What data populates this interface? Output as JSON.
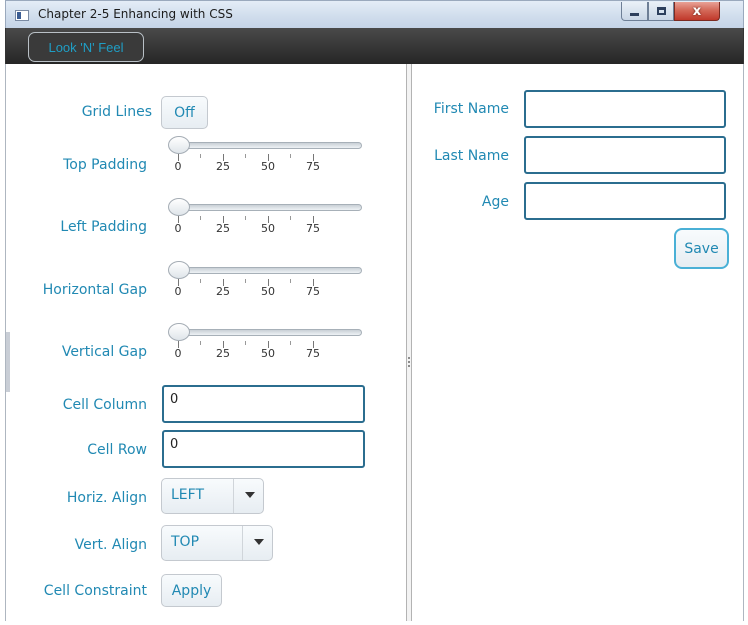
{
  "window": {
    "title": "Chapter 2-5 Enhancing with CSS",
    "close_glyph": "x",
    "icons": {
      "app": "window-app-icon",
      "minimize": "minimize-icon",
      "maximize": "maximize-icon",
      "close": "close-icon"
    }
  },
  "menu": {
    "look_n_feel": "Look 'N' Feel"
  },
  "left": {
    "grid_lines": {
      "label": "Grid Lines",
      "button": "Off"
    },
    "sliders": [
      {
        "label": "Top Padding",
        "value": 0,
        "ticks": [
          "0",
          "25",
          "50",
          "75"
        ]
      },
      {
        "label": "Left Padding",
        "value": 0,
        "ticks": [
          "0",
          "25",
          "50",
          "75"
        ]
      },
      {
        "label": "Horizontal Gap",
        "value": 0,
        "ticks": [
          "0",
          "25",
          "50",
          "75"
        ]
      },
      {
        "label": "Vertical Gap",
        "value": 0,
        "ticks": [
          "0",
          "25",
          "50",
          "75"
        ]
      }
    ],
    "cell_column": {
      "label": "Cell Column",
      "value": "0"
    },
    "cell_row": {
      "label": "Cell Row",
      "value": "0"
    },
    "horiz_align": {
      "label": "Horiz. Align",
      "value": "LEFT"
    },
    "vert_align": {
      "label": "Vert. Align",
      "value": "TOP"
    },
    "cell_constraint": {
      "label": "Cell Constraint",
      "button": "Apply"
    }
  },
  "right": {
    "first_name": {
      "label": "First Name",
      "value": ""
    },
    "last_name": {
      "label": "Last Name",
      "value": ""
    },
    "age": {
      "label": "Age",
      "value": ""
    },
    "save": "Save"
  },
  "colors": {
    "label_text": "#2189b3",
    "field_border": "#2b6d8f",
    "toolbar_bg": "#2f2f2f",
    "close_button": "#c0392b"
  }
}
